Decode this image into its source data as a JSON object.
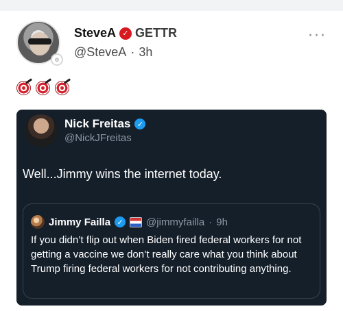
{
  "post": {
    "display_name": "SteveA",
    "platform": "GETTR",
    "handle": "@SteveA",
    "separator": "·",
    "time": "3h",
    "more": "···",
    "emoji_count": 3
  },
  "quoted_post": {
    "author": "Nick Freitas",
    "handle": "@NickJFreitas",
    "text": "Well...Jimmy wins the internet today.",
    "nested_quote": {
      "author": "Jimmy Failla",
      "handle": "@jimmyfailla",
      "separator": "·",
      "time": "9h",
      "text": "If you didn’t flip out when Biden fired federal workers for not getting a vaccine we don’t really care what you think about Trump firing federal workers for not contributing anything."
    }
  },
  "colors": {
    "card_background": "#151f2a",
    "verified_blue": "#1d9bf0",
    "gettr_red": "#d71920"
  },
  "icons": {
    "post_badge": "gettr-badge-icon",
    "card_verified": "blue-check-icon",
    "more": "more-options-icon",
    "emoji": "direct-hit-icon"
  }
}
